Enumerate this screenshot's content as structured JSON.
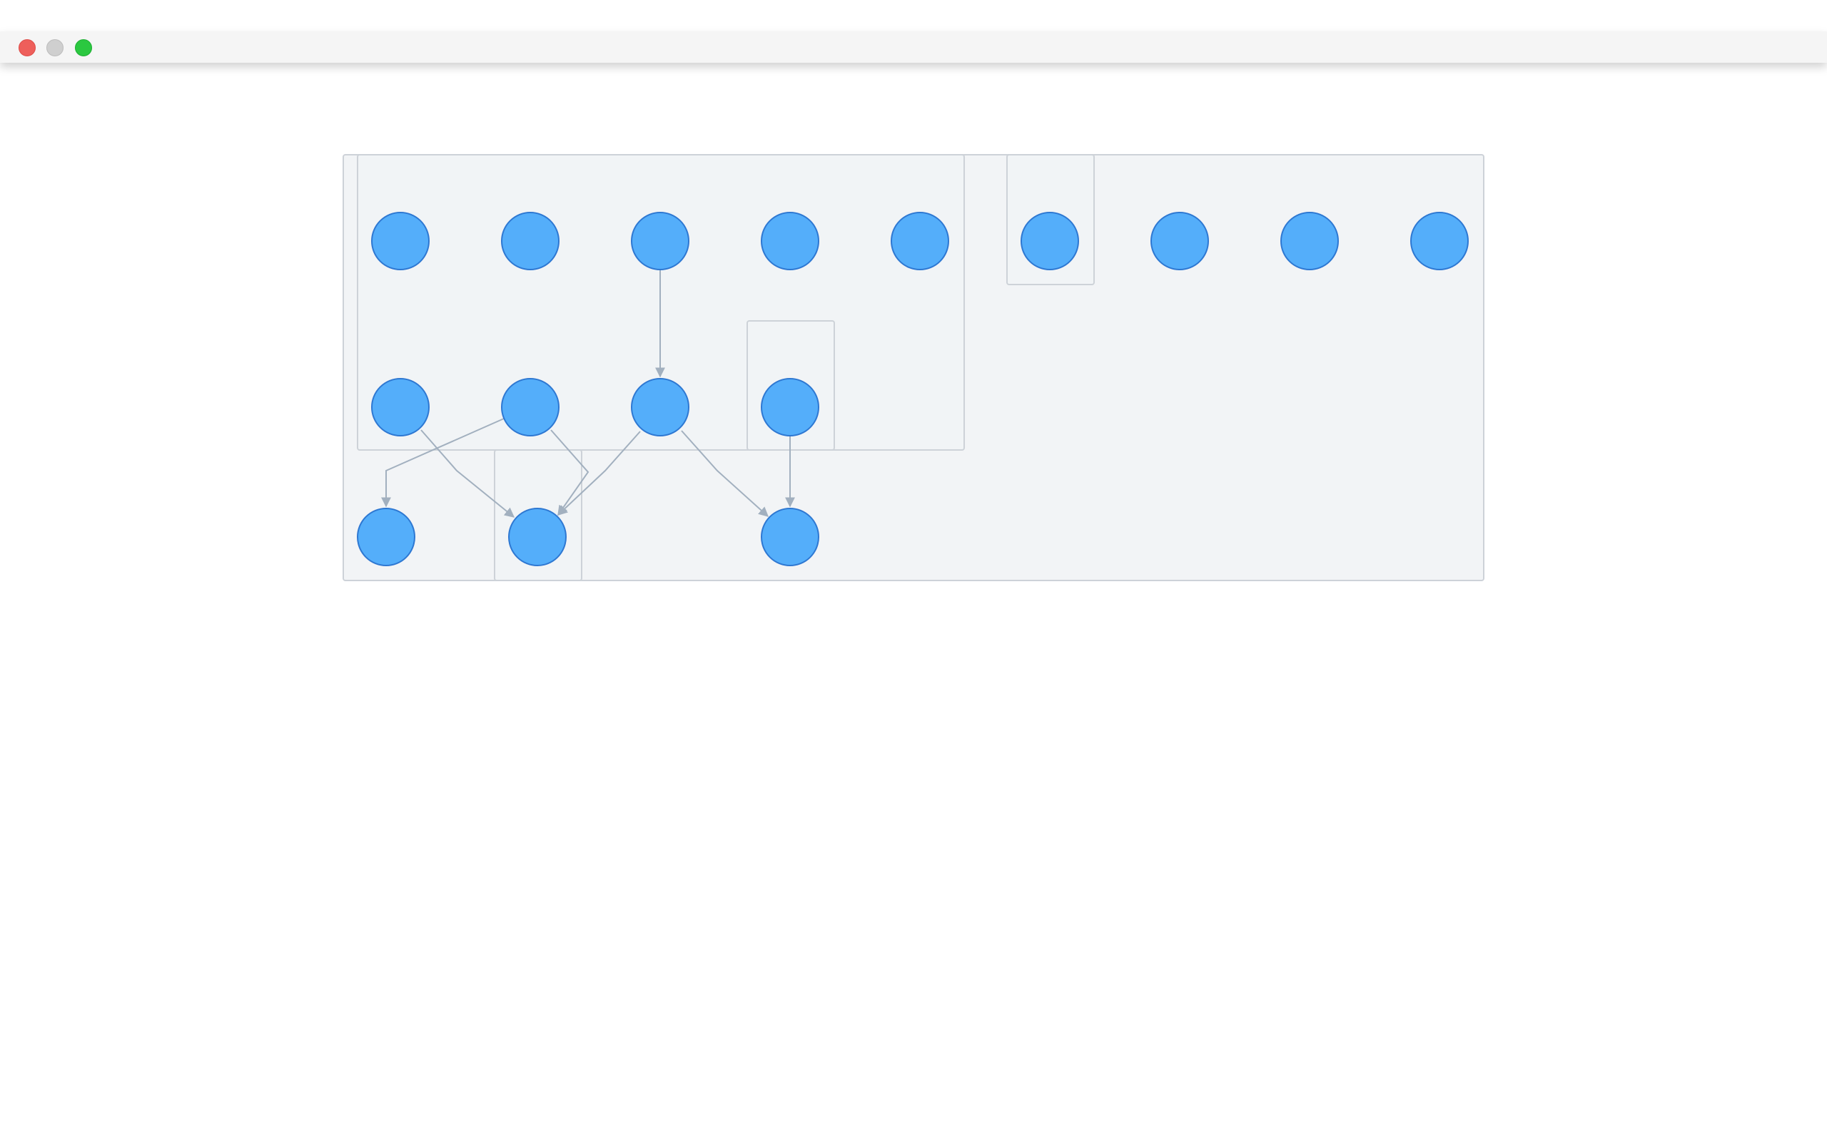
{
  "window": {
    "controls": [
      "close",
      "minimize",
      "maximize"
    ],
    "colors": {
      "close": "#ee5f5b",
      "minimize": "#cfcfcf",
      "maximize": "#2bc840"
    }
  },
  "diagram": {
    "colors": {
      "node_fill": "#54aefa",
      "node_stroke": "#2e78d2",
      "edge": "#a2b0bf",
      "group_fill": "#f2f4f6",
      "group_stroke": "#cdd2d8"
    },
    "nodes": [
      {
        "id": "n1"
      },
      {
        "id": "n2"
      },
      {
        "id": "n3"
      },
      {
        "id": "n4"
      },
      {
        "id": "n5"
      },
      {
        "id": "n6"
      },
      {
        "id": "n7"
      },
      {
        "id": "n8"
      },
      {
        "id": "n9"
      },
      {
        "id": "n10"
      },
      {
        "id": "n11"
      },
      {
        "id": "n12"
      },
      {
        "id": "n13"
      },
      {
        "id": "n14"
      },
      {
        "id": "n15"
      },
      {
        "id": "n16"
      }
    ],
    "edges": [
      {
        "from": "n3",
        "to": "n12"
      },
      {
        "from": "n13",
        "to": "n16"
      },
      {
        "from": "n10",
        "to": "n15"
      },
      {
        "from": "n11",
        "to": "n14"
      },
      {
        "from": "n11",
        "to": "n15"
      },
      {
        "from": "n12",
        "to": "n15"
      },
      {
        "from": "n12",
        "to": "n16"
      }
    ]
  }
}
